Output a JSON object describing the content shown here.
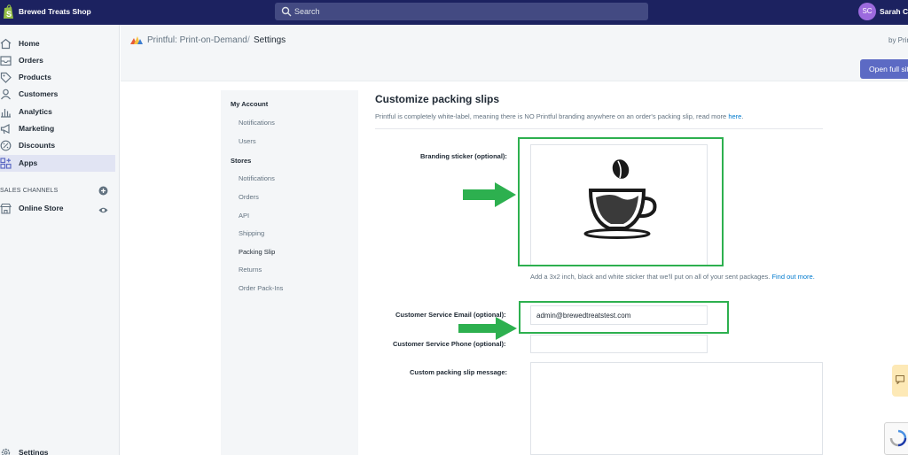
{
  "topbar": {
    "shop_name": "Brewed Treats Shop",
    "search_placeholder": "Search",
    "avatar_initials": "SC",
    "user_name": "Sarah Ch"
  },
  "sidebar": {
    "items": [
      {
        "label": "Home",
        "icon": "home-icon"
      },
      {
        "label": "Orders",
        "icon": "orders-icon"
      },
      {
        "label": "Products",
        "icon": "tag-icon"
      },
      {
        "label": "Customers",
        "icon": "person-icon"
      },
      {
        "label": "Analytics",
        "icon": "bar-chart-icon"
      },
      {
        "label": "Marketing",
        "icon": "megaphone-icon"
      },
      {
        "label": "Discounts",
        "icon": "discount-icon"
      },
      {
        "label": "Apps",
        "icon": "apps-icon",
        "active": true
      }
    ],
    "sales_channels_title": "SALES CHANNELS",
    "online_store_label": "Online Store",
    "settings_label": "Settings"
  },
  "header": {
    "app_name": "Printful: Print-on-Demand",
    "separator": "/",
    "page_name": "Settings",
    "by_text": "by Prin",
    "open_button_label": "Open full sit"
  },
  "settings_nav": {
    "my_account_title": "My Account",
    "my_account_items": [
      "Notifications",
      "Users"
    ],
    "stores_title": "Stores",
    "stores_items": [
      "Notifications",
      "Orders",
      "API",
      "Shipping",
      "Packing Slip",
      "Returns",
      "Order Pack-Ins"
    ],
    "active_item": "Packing Slip"
  },
  "form": {
    "title": "Customize packing slips",
    "description": "Printful is completely white-label, meaning there is NO Printful branding anywhere on an order's packing slip, read more",
    "description_link": "here",
    "description_end": ".",
    "branding_label": "Branding sticker (optional):",
    "branding_help": "Add a 3x2 inch, black and white sticker that we'll put on all of your sent packages.",
    "branding_help_link": "Find out more.",
    "email_label": "Customer Service Email (optional):",
    "email_value": "admin@brewedtreatstest.com",
    "phone_label": "Customer Service Phone (optional):",
    "phone_value": "",
    "message_label": "Custom packing slip message:",
    "message_value": ""
  },
  "colors": {
    "topbar": "#1c2260",
    "highlight": "#2db04f",
    "arrow": "#2db04f",
    "primary_button": "#5c6ac4"
  }
}
